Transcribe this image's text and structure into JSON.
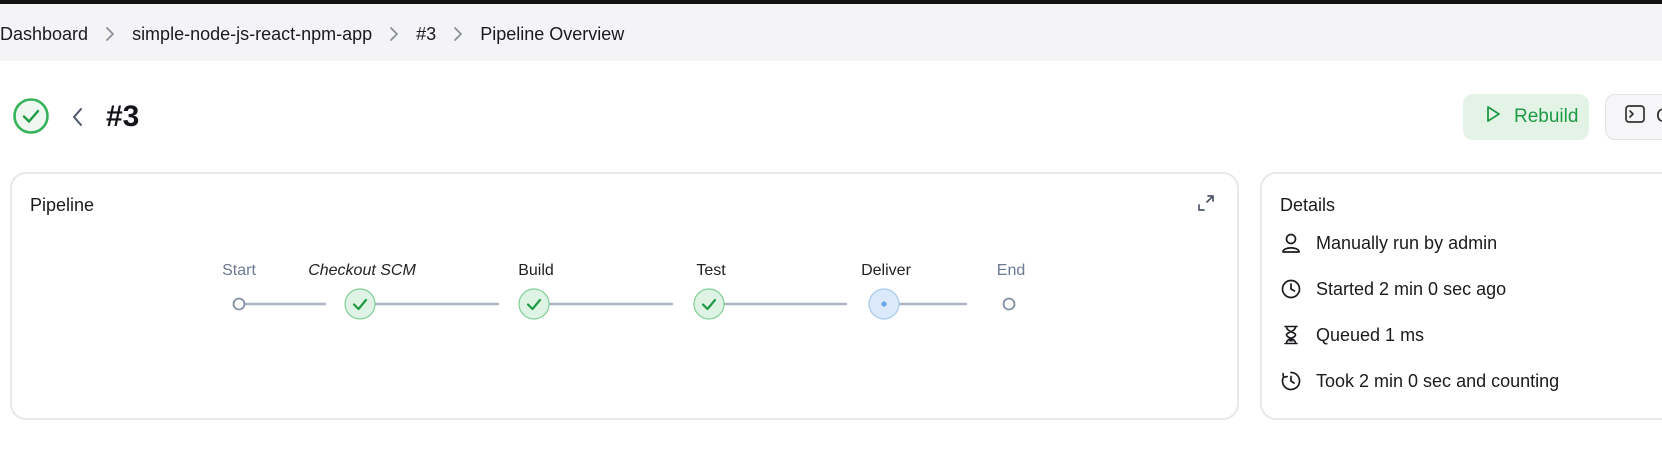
{
  "breadcrumb": {
    "items": [
      "Dashboard",
      "simple-node-js-react-npm-app",
      "#3",
      "Pipeline Overview"
    ]
  },
  "run": {
    "title": "#3",
    "status_icon": "success-check-icon",
    "rebuild_label": "Rebuild",
    "console_label": "C"
  },
  "pipeline": {
    "title": "Pipeline",
    "stages": [
      {
        "label": "Start",
        "state": "start"
      },
      {
        "label": "Checkout SCM",
        "state": "success"
      },
      {
        "label": "Build",
        "state": "success"
      },
      {
        "label": "Test",
        "state": "success"
      },
      {
        "label": "Deliver",
        "state": "running"
      },
      {
        "label": "End",
        "state": "end"
      }
    ]
  },
  "details": {
    "title": "Details",
    "rows": [
      {
        "icon": "user-icon",
        "text": "Manually run by admin"
      },
      {
        "icon": "clock-icon",
        "text": "Started 2 min 0 sec ago"
      },
      {
        "icon": "hourglass-icon",
        "text": "Queued 1 ms"
      },
      {
        "icon": "timer-icon",
        "text": "Took 2 min 0 sec and counting"
      }
    ]
  },
  "colors": {
    "success": "#1f9a45",
    "success_bg": "#dff3e4",
    "running": "#6aa6e8",
    "running_bg": "#dbe9fb",
    "connector": "#aab4c4"
  }
}
